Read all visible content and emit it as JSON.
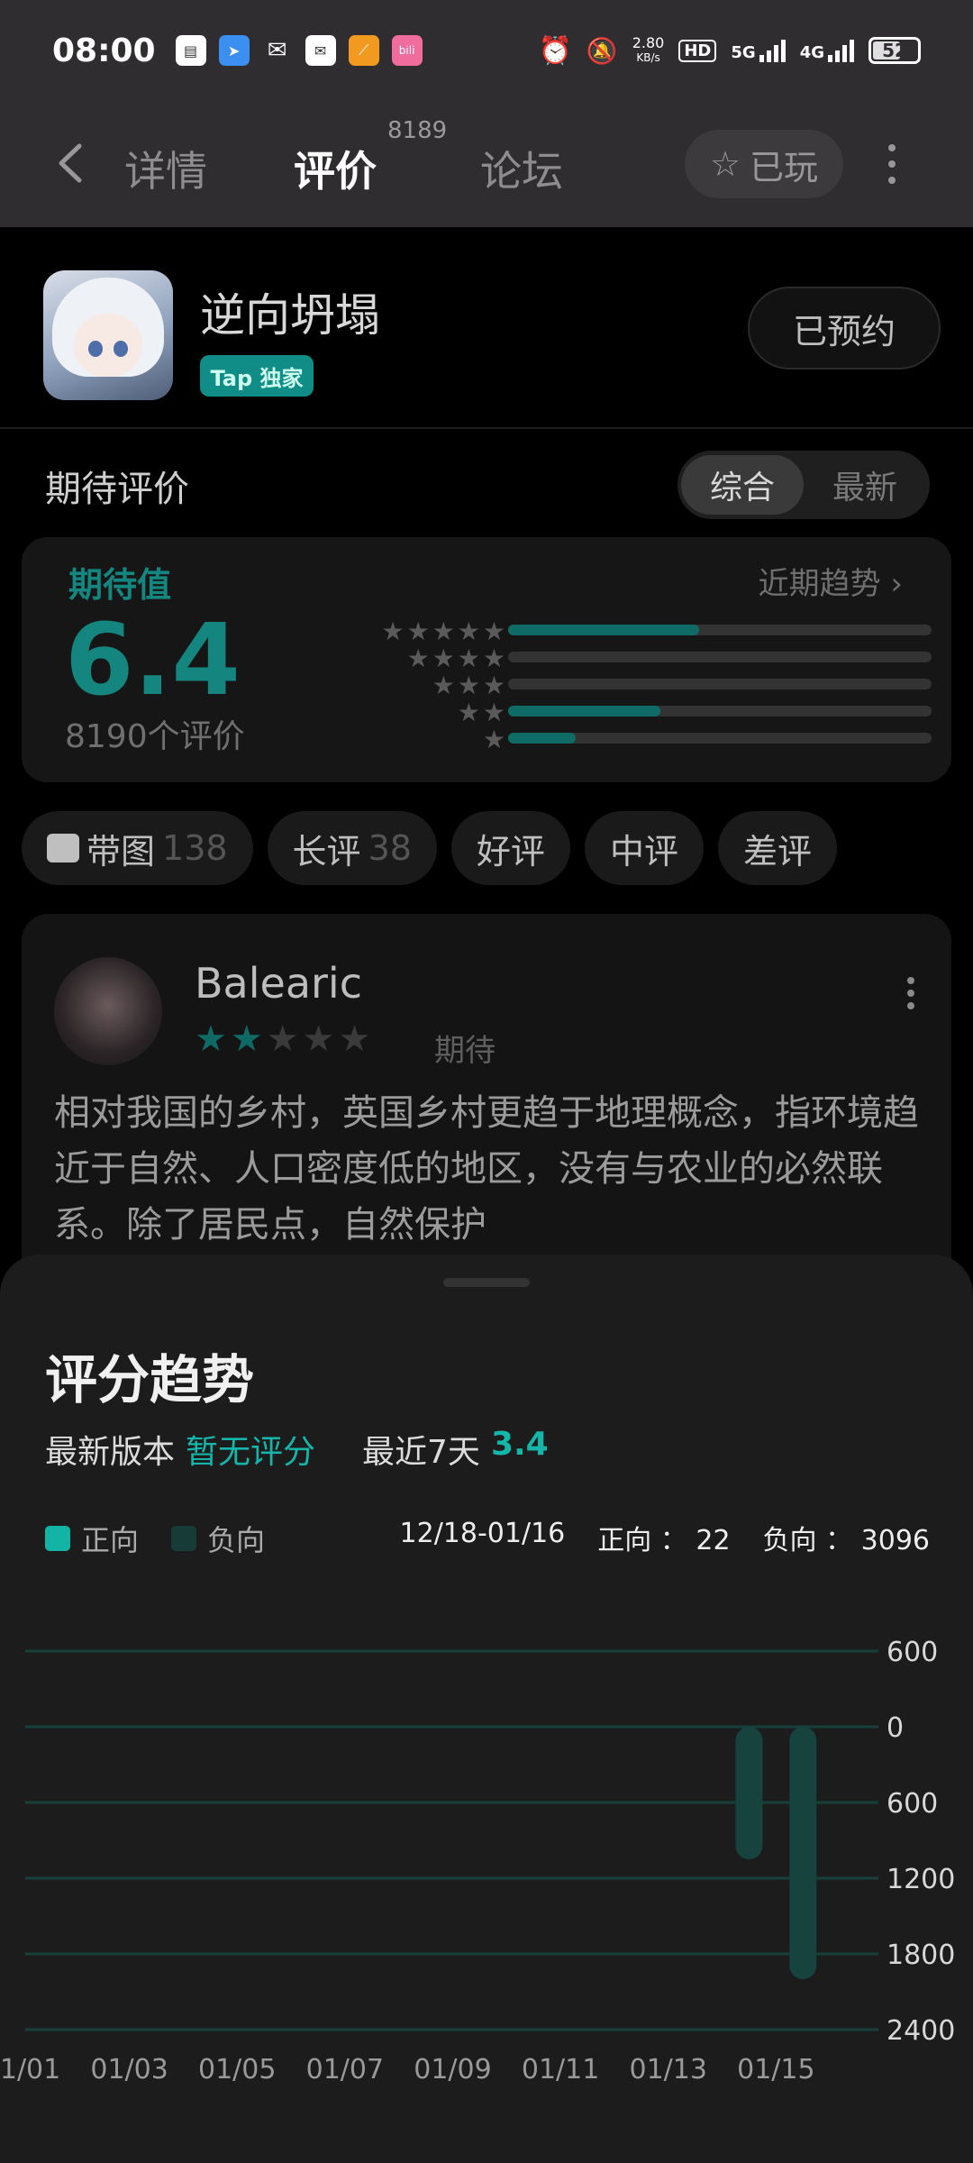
{
  "status_bar": {
    "time": "08:00",
    "net_speed_value": "2.80",
    "net_speed_unit": "KB/s",
    "hd_label": "HD",
    "net_5g": "5G",
    "net_4g": "4G",
    "battery": "52"
  },
  "nav": {
    "tabs": [
      {
        "label": "详情"
      },
      {
        "label": "评价"
      },
      {
        "label": "论坛"
      }
    ],
    "review_count": "8189",
    "played_label": "已玩"
  },
  "game": {
    "name": "逆向坍塌",
    "badge": "Tap 独家",
    "reserve_label": "已预约"
  },
  "expectation": {
    "section_title": "期待评价",
    "sort_options": [
      "综合",
      "最新"
    ],
    "label": "期待值",
    "value": "6.4",
    "count_text": "8190个评价",
    "trend_link": "近期趋势",
    "distribution": [
      {
        "stars": 5,
        "fraction": 0.45
      },
      {
        "stars": 4,
        "fraction": 0.0
      },
      {
        "stars": 3,
        "fraction": 0.0
      },
      {
        "stars": 2,
        "fraction": 0.36
      },
      {
        "stars": 1,
        "fraction": 0.16
      }
    ]
  },
  "filters": [
    {
      "label": "带图",
      "count": "138"
    },
    {
      "label": "长评",
      "count": "38"
    },
    {
      "label": "好评",
      "count": ""
    },
    {
      "label": "中评",
      "count": ""
    },
    {
      "label": "差评",
      "count": ""
    }
  ],
  "review": {
    "author": "Balearic",
    "rating": 2,
    "tag": "期待",
    "text": "相对我国的乡村，英国乡村更趋于地理概念，指环境趋近于自然、人口密度低的地区，没有与农业的必然联系。除了居民点，自然保护"
  },
  "trend_sheet": {
    "title": "评分趋势",
    "latest_version_label": "最新版本",
    "latest_version_value": "暂无评分",
    "recent_label": "最近7天",
    "recent_value": "3.4",
    "legend": [
      {
        "name": "正向",
        "color": "#13b3a6"
      },
      {
        "name": "负向",
        "color": "#173b37"
      }
    ],
    "date_range": "12/18-01/16",
    "positive_label": "正向 ：",
    "positive_value": "22",
    "negative_label": "负向 ：",
    "negative_value": "3096"
  },
  "chart_data": {
    "type": "bar",
    "title": "",
    "y_tick_labels": [
      "600",
      "0",
      "600",
      "1200",
      "1800",
      "2400"
    ],
    "y_tick_values": [
      600,
      0,
      -600,
      -1200,
      -1800,
      -2400
    ],
    "ylim": [
      -2400,
      600
    ],
    "x_tick_labels": [
      "01/01",
      "01/03",
      "01/05",
      "01/07",
      "01/09",
      "01/11",
      "01/13",
      "01/15"
    ],
    "x_tick_days": [
      1,
      3,
      5,
      7,
      9,
      11,
      13,
      15
    ],
    "xlim_days": [
      1,
      16.9
    ],
    "series": [
      {
        "name": "负向",
        "points": [
          {
            "day": 14.5,
            "value": -1050
          },
          {
            "day": 15.5,
            "value": -2000
          }
        ]
      }
    ],
    "grid": true
  }
}
